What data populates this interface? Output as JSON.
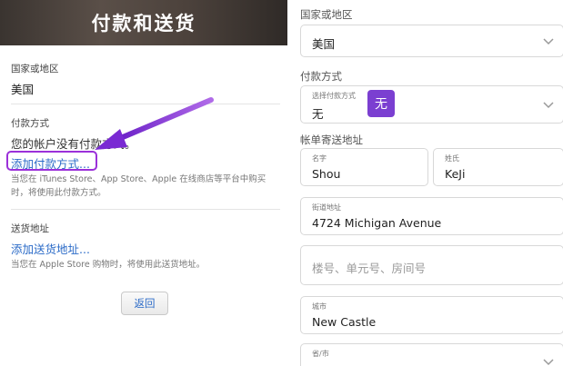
{
  "left": {
    "title": "付款和送货",
    "country": {
      "label": "国家或地区",
      "value": "美国"
    },
    "payment": {
      "label": "付款方式",
      "no_method": "您的帐户没有付款方式。",
      "add_link": "添加付款方式...",
      "note": "当您在 iTunes Store、App Store、Apple 在线商店等平台中购买时，将使用此付款方式。"
    },
    "shipping": {
      "label": "送货地址",
      "add_link": "添加送货地址...",
      "note": "当您在 Apple Store 购物时，将使用此送货地址。"
    },
    "back_label": "返回",
    "accent": "#9b30d9"
  },
  "right": {
    "country": {
      "label": "国家或地区",
      "value": "美国"
    },
    "payment": {
      "label": "付款方式",
      "field_label": "选择付款方式",
      "value": "无",
      "badge": "无"
    },
    "billing": {
      "label": "帐单寄送地址",
      "first_name": {
        "label": "名字",
        "value": "Shou"
      },
      "last_name": {
        "label": "姓氏",
        "value": "KeJi"
      },
      "street": {
        "label": "街道地址",
        "value": "4724 Michigan Avenue"
      },
      "unit": {
        "placeholder": "楼号、单元号、房间号"
      },
      "city": {
        "label": "城市",
        "value": "New Castle"
      },
      "state": {
        "label": "省/市"
      }
    },
    "badge_color": "#7b3fd1"
  }
}
